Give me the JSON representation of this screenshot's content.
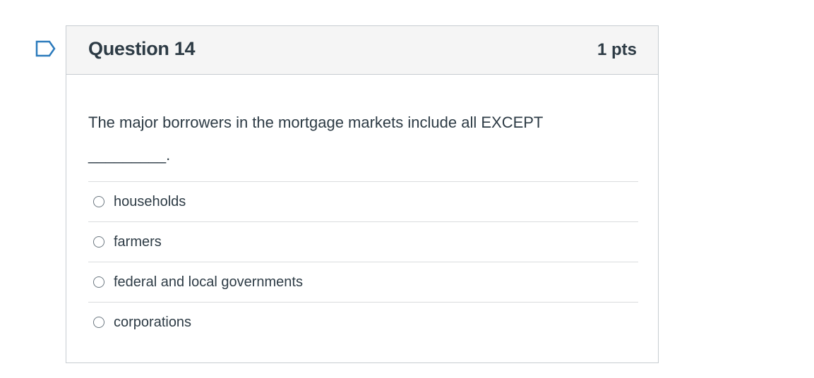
{
  "question": {
    "title": "Question 14",
    "points": "1 pts",
    "text": "The major borrowers in the mortgage markets include all EXCEPT _________."
  },
  "answers": [
    {
      "label": "households"
    },
    {
      "label": "farmers"
    },
    {
      "label": "federal and local governments"
    },
    {
      "label": "corporations"
    }
  ],
  "colors": {
    "flag_outline": "#2b7abc",
    "header_bg": "#f5f5f5",
    "border": "#c7cdd1",
    "text": "#2d3b45"
  },
  "icons": {
    "flag": "bookmark-flag-icon",
    "radio": "radio-unchecked-icon"
  }
}
